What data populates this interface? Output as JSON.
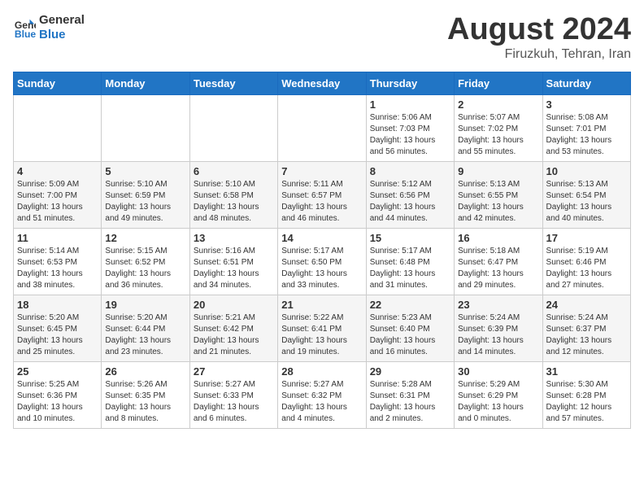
{
  "header": {
    "logo_line1": "General",
    "logo_line2": "Blue",
    "main_title": "August 2024",
    "subtitle": "Firuzkuh, Tehran, Iran"
  },
  "weekdays": [
    "Sunday",
    "Monday",
    "Tuesday",
    "Wednesday",
    "Thursday",
    "Friday",
    "Saturday"
  ],
  "weeks": [
    [
      {
        "day": "",
        "detail": ""
      },
      {
        "day": "",
        "detail": ""
      },
      {
        "day": "",
        "detail": ""
      },
      {
        "day": "",
        "detail": ""
      },
      {
        "day": "1",
        "detail": "Sunrise: 5:06 AM\nSunset: 7:03 PM\nDaylight: 13 hours\nand 56 minutes."
      },
      {
        "day": "2",
        "detail": "Sunrise: 5:07 AM\nSunset: 7:02 PM\nDaylight: 13 hours\nand 55 minutes."
      },
      {
        "day": "3",
        "detail": "Sunrise: 5:08 AM\nSunset: 7:01 PM\nDaylight: 13 hours\nand 53 minutes."
      }
    ],
    [
      {
        "day": "4",
        "detail": "Sunrise: 5:09 AM\nSunset: 7:00 PM\nDaylight: 13 hours\nand 51 minutes."
      },
      {
        "day": "5",
        "detail": "Sunrise: 5:10 AM\nSunset: 6:59 PM\nDaylight: 13 hours\nand 49 minutes."
      },
      {
        "day": "6",
        "detail": "Sunrise: 5:10 AM\nSunset: 6:58 PM\nDaylight: 13 hours\nand 48 minutes."
      },
      {
        "day": "7",
        "detail": "Sunrise: 5:11 AM\nSunset: 6:57 PM\nDaylight: 13 hours\nand 46 minutes."
      },
      {
        "day": "8",
        "detail": "Sunrise: 5:12 AM\nSunset: 6:56 PM\nDaylight: 13 hours\nand 44 minutes."
      },
      {
        "day": "9",
        "detail": "Sunrise: 5:13 AM\nSunset: 6:55 PM\nDaylight: 13 hours\nand 42 minutes."
      },
      {
        "day": "10",
        "detail": "Sunrise: 5:13 AM\nSunset: 6:54 PM\nDaylight: 13 hours\nand 40 minutes."
      }
    ],
    [
      {
        "day": "11",
        "detail": "Sunrise: 5:14 AM\nSunset: 6:53 PM\nDaylight: 13 hours\nand 38 minutes."
      },
      {
        "day": "12",
        "detail": "Sunrise: 5:15 AM\nSunset: 6:52 PM\nDaylight: 13 hours\nand 36 minutes."
      },
      {
        "day": "13",
        "detail": "Sunrise: 5:16 AM\nSunset: 6:51 PM\nDaylight: 13 hours\nand 34 minutes."
      },
      {
        "day": "14",
        "detail": "Sunrise: 5:17 AM\nSunset: 6:50 PM\nDaylight: 13 hours\nand 33 minutes."
      },
      {
        "day": "15",
        "detail": "Sunrise: 5:17 AM\nSunset: 6:48 PM\nDaylight: 13 hours\nand 31 minutes."
      },
      {
        "day": "16",
        "detail": "Sunrise: 5:18 AM\nSunset: 6:47 PM\nDaylight: 13 hours\nand 29 minutes."
      },
      {
        "day": "17",
        "detail": "Sunrise: 5:19 AM\nSunset: 6:46 PM\nDaylight: 13 hours\nand 27 minutes."
      }
    ],
    [
      {
        "day": "18",
        "detail": "Sunrise: 5:20 AM\nSunset: 6:45 PM\nDaylight: 13 hours\nand 25 minutes."
      },
      {
        "day": "19",
        "detail": "Sunrise: 5:20 AM\nSunset: 6:44 PM\nDaylight: 13 hours\nand 23 minutes."
      },
      {
        "day": "20",
        "detail": "Sunrise: 5:21 AM\nSunset: 6:42 PM\nDaylight: 13 hours\nand 21 minutes."
      },
      {
        "day": "21",
        "detail": "Sunrise: 5:22 AM\nSunset: 6:41 PM\nDaylight: 13 hours\nand 19 minutes."
      },
      {
        "day": "22",
        "detail": "Sunrise: 5:23 AM\nSunset: 6:40 PM\nDaylight: 13 hours\nand 16 minutes."
      },
      {
        "day": "23",
        "detail": "Sunrise: 5:24 AM\nSunset: 6:39 PM\nDaylight: 13 hours\nand 14 minutes."
      },
      {
        "day": "24",
        "detail": "Sunrise: 5:24 AM\nSunset: 6:37 PM\nDaylight: 13 hours\nand 12 minutes."
      }
    ],
    [
      {
        "day": "25",
        "detail": "Sunrise: 5:25 AM\nSunset: 6:36 PM\nDaylight: 13 hours\nand 10 minutes."
      },
      {
        "day": "26",
        "detail": "Sunrise: 5:26 AM\nSunset: 6:35 PM\nDaylight: 13 hours\nand 8 minutes."
      },
      {
        "day": "27",
        "detail": "Sunrise: 5:27 AM\nSunset: 6:33 PM\nDaylight: 13 hours\nand 6 minutes."
      },
      {
        "day": "28",
        "detail": "Sunrise: 5:27 AM\nSunset: 6:32 PM\nDaylight: 13 hours\nand 4 minutes."
      },
      {
        "day": "29",
        "detail": "Sunrise: 5:28 AM\nSunset: 6:31 PM\nDaylight: 13 hours\nand 2 minutes."
      },
      {
        "day": "30",
        "detail": "Sunrise: 5:29 AM\nSunset: 6:29 PM\nDaylight: 13 hours\nand 0 minutes."
      },
      {
        "day": "31",
        "detail": "Sunrise: 5:30 AM\nSunset: 6:28 PM\nDaylight: 12 hours\nand 57 minutes."
      }
    ]
  ]
}
